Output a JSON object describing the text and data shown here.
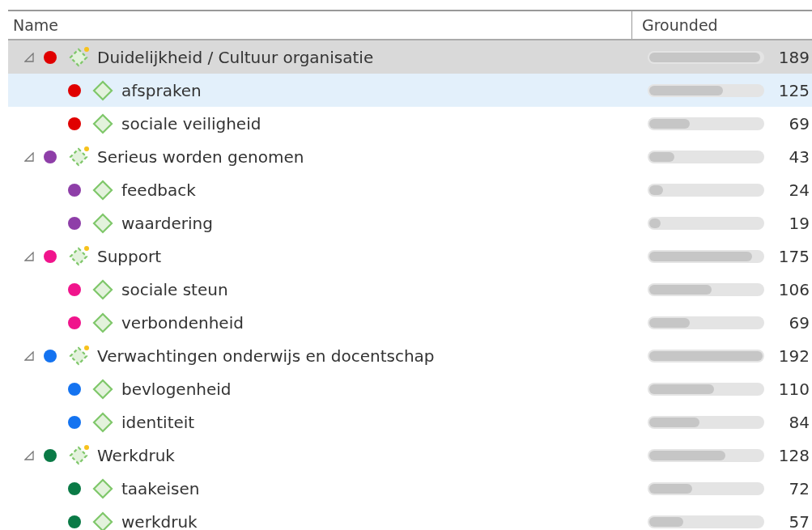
{
  "columns": [
    "Name",
    "Grounded"
  ],
  "codes": [
    {
      "name": "Duidelijkheid / Cultuur organisatie",
      "color": "#e00000",
      "expanded": true,
      "selected": true,
      "hovered": false,
      "level": 0.98,
      "count": "189",
      "children": [
        {
          "name": "afspraken",
          "color": "#e00000",
          "selected": false,
          "hovered": true,
          "level": 0.65,
          "count": "125"
        },
        {
          "name": "sociale veiligheid",
          "color": "#e00000",
          "selected": false,
          "hovered": false,
          "level": 0.36,
          "count": "69"
        }
      ]
    },
    {
      "name": "Serieus worden genomen",
      "color": "#8e3ea8",
      "expanded": true,
      "selected": false,
      "hovered": false,
      "level": 0.22,
      "count": "43",
      "children": [
        {
          "name": "feedback",
          "color": "#8e3ea8",
          "selected": false,
          "hovered": false,
          "level": 0.12,
          "count": "24"
        },
        {
          "name": "waardering",
          "color": "#8e3ea8",
          "selected": false,
          "hovered": false,
          "level": 0.1,
          "count": "19"
        }
      ]
    },
    {
      "name": "Support",
      "color": "#f0148c",
      "expanded": true,
      "selected": false,
      "hovered": false,
      "level": 0.91,
      "count": "175",
      "children": [
        {
          "name": "sociale steun",
          "color": "#f0148c",
          "selected": false,
          "hovered": false,
          "level": 0.55,
          "count": "106"
        },
        {
          "name": "verbondenheid",
          "color": "#f0148c",
          "selected": false,
          "hovered": false,
          "level": 0.36,
          "count": "69"
        }
      ]
    },
    {
      "name": "Verwachtingen onderwijs en docentschap",
      "color": "#1473f0",
      "expanded": true,
      "selected": false,
      "hovered": false,
      "level": 1.0,
      "count": "192",
      "children": [
        {
          "name": "bevlogenheid",
          "color": "#1473f0",
          "selected": false,
          "hovered": false,
          "level": 0.57,
          "count": "110"
        },
        {
          "name": "identiteit",
          "color": "#1473f0",
          "selected": false,
          "hovered": false,
          "level": 0.44,
          "count": "84"
        }
      ]
    },
    {
      "name": "Werkdruk",
      "color": "#0a7a46",
      "expanded": true,
      "selected": false,
      "hovered": false,
      "level": 0.67,
      "count": "128",
      "children": [
        {
          "name": "taakeisen",
          "color": "#0a7a46",
          "selected": false,
          "hovered": false,
          "level": 0.38,
          "count": "72"
        },
        {
          "name": "werkdruk",
          "color": "#0a7a46",
          "selected": false,
          "hovered": false,
          "level": 0.3,
          "count": "57"
        }
      ]
    }
  ]
}
